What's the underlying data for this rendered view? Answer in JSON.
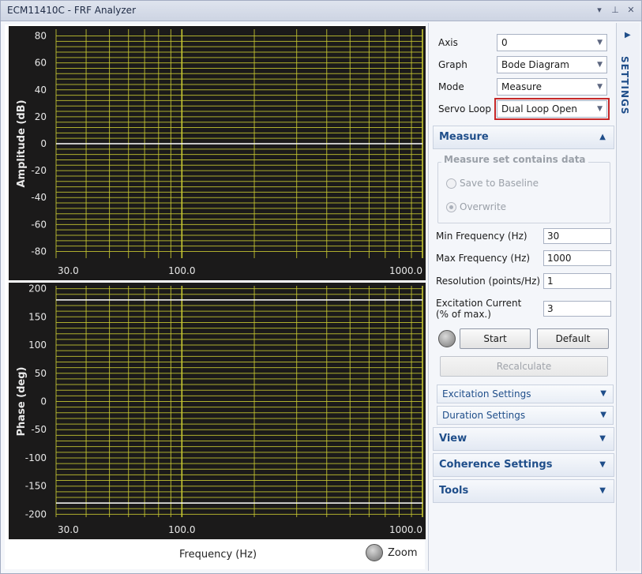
{
  "window": {
    "title": "ECM11410C - FRF Analyzer"
  },
  "titlebar_icons": [
    "dropdown-icon",
    "pin-icon",
    "close-icon"
  ],
  "settings": {
    "axis": {
      "label": "Axis",
      "value": "0"
    },
    "graph": {
      "label": "Graph",
      "value": "Bode Diagram"
    },
    "mode": {
      "label": "Mode",
      "value": "Measure"
    },
    "servo_loop": {
      "label": "Servo Loop",
      "value": "Dual Loop Open"
    }
  },
  "measure": {
    "header": "Measure",
    "group_title": "Measure set contains data",
    "save_baseline": "Save to Baseline",
    "overwrite": "Overwrite",
    "min_freq": {
      "label": "Min Frequency (Hz)",
      "value": "30"
    },
    "max_freq": {
      "label": "Max Frequency (Hz)",
      "value": "1000"
    },
    "resolution": {
      "label": "Resolution (points/Hz)",
      "value": "1"
    },
    "excitation": {
      "label_line1": "Excitation Current",
      "label_line2": "(% of max.)",
      "value": "3"
    },
    "start": "Start",
    "default": "Default",
    "recalculate": "Recalculate"
  },
  "subsections": {
    "excitation": "Excitation Settings",
    "duration": "Duration Settings"
  },
  "sections": {
    "view": "View",
    "coherence": "Coherence Settings",
    "tools": "Tools"
  },
  "sidebar": {
    "label": "SETTINGS"
  },
  "bottom": {
    "frequency_label": "Frequency (Hz)",
    "zoom": "Zoom"
  },
  "colors": {
    "grid": "#c8c832",
    "plot_bg": "#1b1a1a",
    "accent": "#1f4e8a",
    "highlight": "#c62828"
  },
  "chart_data": [
    {
      "type": "line",
      "title": "",
      "ylabel": "Amplitude (dB)",
      "xlabel": "",
      "xscale": "log",
      "xlim": [
        30.0,
        1000.0
      ],
      "ylim": [
        -85,
        85
      ],
      "yticks": [
        80,
        60,
        40,
        20,
        0,
        -20,
        -40,
        -60,
        -80
      ],
      "xtick_labels": [
        "30.0",
        "100.0",
        "1000.0"
      ],
      "grid": true,
      "series": [
        {
          "x": [
            30.0,
            1000.0
          ],
          "y": [
            0,
            0
          ],
          "color": "#ffffff"
        }
      ]
    },
    {
      "type": "line",
      "title": "",
      "ylabel": "Phase (deg)",
      "xlabel": "Frequency (Hz)",
      "xscale": "log",
      "xlim": [
        30.0,
        1000.0
      ],
      "ylim": [
        -205,
        205
      ],
      "yticks": [
        200,
        150,
        100,
        50,
        0,
        -50,
        -100,
        -150,
        -200
      ],
      "xtick_labels": [
        "30.0",
        "100.0",
        "1000.0"
      ],
      "grid": true,
      "series": [
        {
          "x": [
            30.0,
            1000.0
          ],
          "y": [
            180,
            180
          ],
          "color": "#ffffff"
        },
        {
          "x": [
            30.0,
            1000.0
          ],
          "y": [
            -180,
            -180
          ],
          "color": "#ffffff"
        }
      ]
    }
  ]
}
